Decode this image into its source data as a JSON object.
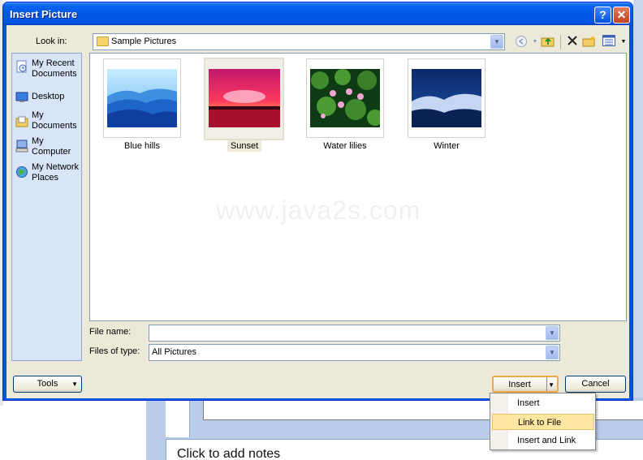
{
  "dialog": {
    "title": "Insert Picture",
    "help_label": "?",
    "close_label": "✕"
  },
  "look_in": {
    "label": "Look in:",
    "value": "Sample Pictures"
  },
  "toolbar": {
    "back_icon": "back-arrow-icon",
    "up_icon": "up-folder-icon",
    "delete_icon": "delete-icon",
    "new_folder_icon": "new-folder-icon",
    "views_icon": "views-icon"
  },
  "places": [
    {
      "label": "My Recent\nDocuments",
      "icon": "recent-documents-icon"
    },
    {
      "label": "Desktop",
      "icon": "desktop-icon"
    },
    {
      "label": "My\nDocuments",
      "icon": "my-documents-icon"
    },
    {
      "label": "My\nComputer",
      "icon": "my-computer-icon"
    },
    {
      "label": "My Network\nPlaces",
      "icon": "network-places-icon"
    }
  ],
  "files": [
    {
      "name": "Blue hills",
      "selected": false
    },
    {
      "name": "Sunset",
      "selected": true
    },
    {
      "name": "Water lilies",
      "selected": false
    },
    {
      "name": "Winter",
      "selected": false
    }
  ],
  "watermark": "www.java2s.com",
  "file_name": {
    "label": "File name:",
    "value": ""
  },
  "file_type": {
    "label": "Files of type:",
    "value": "All Pictures"
  },
  "buttons": {
    "tools": "Tools",
    "insert": "Insert",
    "cancel": "Cancel"
  },
  "insert_menu": [
    {
      "label": "Insert",
      "highlighted": false
    },
    {
      "label": "Link to File",
      "highlighted": true
    },
    {
      "label": "Insert and Link",
      "highlighted": false
    }
  ],
  "background": {
    "notes_placeholder": "Click to add notes"
  },
  "colors": {
    "title_bar": "#0054e3",
    "dialog_face": "#ece9d8",
    "menu_highlight": "#ffe6a0"
  }
}
